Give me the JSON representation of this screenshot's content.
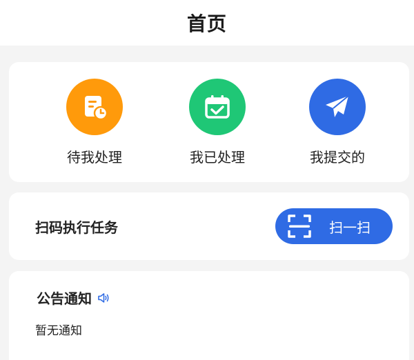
{
  "header": {
    "title": "首页"
  },
  "quick_actions": [
    {
      "label": "待我处理",
      "icon": "pending-document-icon",
      "color": "#ff9a0b"
    },
    {
      "label": "我已处理",
      "icon": "calendar-check-icon",
      "color": "#1fc776"
    },
    {
      "label": "我提交的",
      "icon": "paper-plane-icon",
      "color": "#2f6be4"
    }
  ],
  "scan": {
    "title": "扫码执行任务",
    "button_label": "扫一扫",
    "icon": "scan-frame-icon",
    "color": "#2f6be4"
  },
  "notice": {
    "title": "公告通知",
    "icon": "speaker-icon",
    "empty_text": "暂无通知"
  }
}
